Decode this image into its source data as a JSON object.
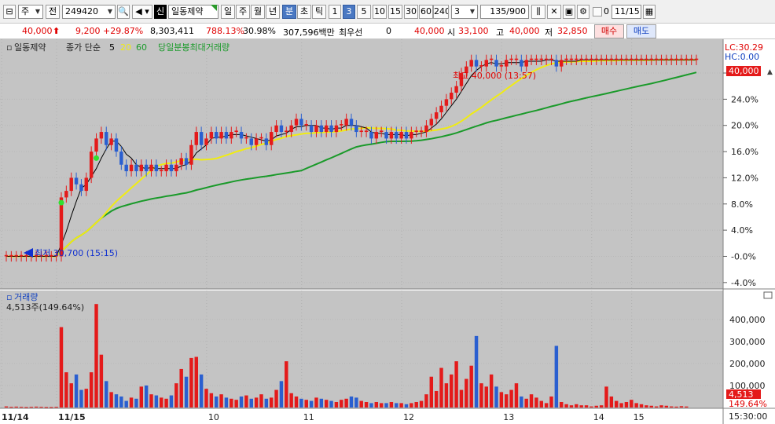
{
  "toolbar": {
    "type_label": "주",
    "prev_label": "전",
    "code": "249420",
    "stock_badge": "신",
    "stock_name": "일동제약",
    "periods": [
      "일",
      "주",
      "월",
      "년",
      "분",
      "초",
      "틱"
    ],
    "active_period": "분",
    "intervals": [
      "1",
      "3",
      "5",
      "10",
      "15",
      "30",
      "60",
      "240"
    ],
    "active_interval": "3",
    "interval_value": "3",
    "count": "135",
    "count_total": "/900",
    "zero_label": "0",
    "date": "11/15"
  },
  "quote": {
    "price": "40,000",
    "change": "9,200",
    "change_rate": "+29.87%",
    "volume": "8,303,411",
    "volume_rate": "788.13%",
    "turnover_rate": "30.98%",
    "amount": "307,596백만",
    "best_bid_label": "최우선",
    "best_bid": "0",
    "ask_price": "40,000",
    "open_label": "시",
    "open": "33,100",
    "high_label": "고",
    "high": "40,000",
    "low_label": "저",
    "low": "32,850",
    "buy_label": "매수",
    "sell_label": "매도"
  },
  "price_panel": {
    "legend_name": "일동제약",
    "legend_ma": "종가 단순",
    "legend_ma5": "5",
    "legend_ma20": "20",
    "legend_ma60": "60",
    "legend_vol_ma": "당일분봉최대거래량",
    "lc_label": "LC:30.29",
    "hc_label": "HC:0.00",
    "current_price_tag": "40,000",
    "high_annotation": "최고 40,000 (13:57)",
    "low_annotation": "최저 30,700 (15:15)",
    "colors": {
      "up": "#e41a1a",
      "down": "#2a5fd0",
      "ma5": "#000000",
      "ma20": "#f0ec12",
      "ma60": "#1a9a2a"
    }
  },
  "volume_panel": {
    "title": "거래량",
    "volume_label": "4,513주(149.64%)",
    "current_volume_tag": "4,513",
    "current_rate_tag": "149.64%"
  },
  "time_axis": {
    "labels": [
      "11/14",
      "11/15",
      "10",
      "11",
      "12",
      "13",
      "14",
      "15"
    ],
    "last_time": "15:30:00"
  },
  "chart_data": [
    {
      "type": "candlestick",
      "title": "",
      "y_unit": "%",
      "y_ticks": [
        "28.0%",
        "24.0%",
        "20.0%",
        "16.0%",
        "12.0%",
        "8.0%",
        "4.0%",
        "-0.0%",
        "-4.0%"
      ],
      "ylim": [
        -4.5,
        31
      ],
      "candles_close_pct": [
        0,
        0,
        0,
        0,
        0,
        0,
        0,
        0,
        0,
        0,
        0,
        9,
        10,
        12,
        11,
        10,
        12,
        16,
        18,
        19,
        17,
        18,
        16,
        14,
        13,
        14,
        13,
        14,
        13,
        14,
        13,
        13,
        14,
        13,
        14,
        15,
        14,
        17,
        19,
        17,
        18,
        19,
        18,
        19,
        18,
        19,
        19,
        18,
        18,
        17,
        18,
        18,
        17,
        19,
        20,
        19,
        19,
        20,
        21,
        20,
        20,
        19,
        20,
        19,
        20,
        19,
        20,
        20,
        21,
        20,
        19,
        19,
        19,
        18,
        19,
        19,
        18,
        19,
        18,
        19,
        18,
        19,
        19,
        19,
        20,
        21,
        22,
        23,
        24,
        25,
        26,
        28,
        29,
        30,
        29,
        29,
        30,
        30,
        29,
        29,
        30,
        30,
        30,
        29,
        30,
        30,
        30,
        30,
        30,
        30,
        29,
        30,
        30,
        30,
        30,
        30,
        30,
        30,
        30,
        30,
        30,
        30,
        30,
        30,
        30,
        30,
        30,
        30,
        30,
        30,
        30,
        30,
        30,
        30,
        30,
        30,
        30,
        30,
        30
      ],
      "series": [
        {
          "name": "5",
          "kind": "moving average of close"
        },
        {
          "name": "20",
          "kind": "moving average of close"
        },
        {
          "name": "60",
          "kind": "moving average of close"
        }
      ],
      "annotations": [
        "최고 40,000 (13:57)",
        "최저 30,700 (15:15)"
      ]
    },
    {
      "type": "bar",
      "title": "거래량",
      "y_ticks": [
        "400,000",
        "300,000",
        "200,000",
        "100,000"
      ],
      "ylim": [
        0,
        460000
      ],
      "values": [
        5000,
        3000,
        4000,
        3000,
        2000,
        3000,
        4000,
        3000,
        2000,
        2000,
        3000,
        365000,
        160000,
        110000,
        150000,
        80000,
        85000,
        160000,
        470000,
        240000,
        120000,
        70000,
        60000,
        50000,
        30000,
        45000,
        40000,
        95000,
        100000,
        60000,
        55000,
        45000,
        40000,
        55000,
        110000,
        175000,
        140000,
        225000,
        230000,
        150000,
        85000,
        65000,
        50000,
        60000,
        45000,
        40000,
        35000,
        50000,
        55000,
        40000,
        45000,
        60000,
        40000,
        45000,
        80000,
        120000,
        210000,
        65000,
        50000,
        40000,
        35000,
        30000,
        45000,
        40000,
        35000,
        30000,
        25000,
        35000,
        40000,
        50000,
        45000,
        30000,
        25000,
        20000,
        25000,
        20000,
        20000,
        25000,
        20000,
        20000,
        15000,
        20000,
        25000,
        30000,
        60000,
        140000,
        75000,
        180000,
        110000,
        150000,
        210000,
        80000,
        130000,
        190000,
        325000,
        110000,
        95000,
        150000,
        95000,
        70000,
        60000,
        80000,
        110000,
        50000,
        40000,
        60000,
        45000,
        30000,
        20000,
        50000,
        280000,
        25000,
        15000,
        10000,
        15000,
        10000,
        10000,
        5000,
        8000,
        10000,
        95000,
        50000,
        30000,
        20000,
        25000,
        35000,
        20000,
        15000,
        10000,
        8000,
        5000,
        10000,
        8000,
        5000,
        4000,
        6000,
        4513
      ]
    }
  ]
}
